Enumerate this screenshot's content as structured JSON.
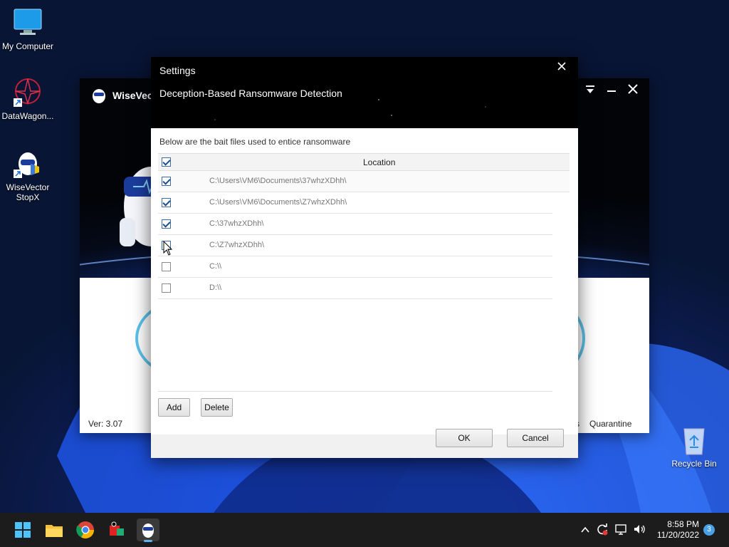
{
  "desktop": {
    "icons": [
      {
        "label": "My Computer"
      },
      {
        "label": "DataWagon..."
      },
      {
        "label": "WiseVector StopX"
      }
    ],
    "recycle_bin": "Recycle Bin"
  },
  "app": {
    "name": "WiseVec",
    "version": "Ver: 3.07",
    "footer_s": "s",
    "quarantine": "Quarantine"
  },
  "dialog": {
    "title": "Settings",
    "subtitle": "Deception-Based Ransomware Detection",
    "description": "Below are the bait files used to entice ransomware",
    "column_location": "Location",
    "header_checked": true,
    "rows": [
      {
        "path": "C:\\Users\\VM6\\Documents\\37whzXDhh\\",
        "checked": true
      },
      {
        "path": "C:\\Users\\VM6\\Documents\\Z7whzXDhh\\",
        "checked": true
      },
      {
        "path": "C:\\37whzXDhh\\",
        "checked": true
      },
      {
        "path": "C:\\Z7whzXDhh\\",
        "checked": false
      },
      {
        "path": "C:\\\\",
        "checked": false
      },
      {
        "path": "D:\\\\",
        "checked": false
      }
    ],
    "add_label": "Add",
    "delete_label": "Delete",
    "ok_label": "OK",
    "cancel_label": "Cancel"
  },
  "taskbar": {
    "time": "8:58 PM",
    "date": "11/20/2022",
    "notification_count": "3",
    "icons": [
      "windows-start-icon",
      "file-explorer-icon",
      "chrome-icon",
      "media-app-icon",
      "wisevector-icon"
    ]
  },
  "colors": {
    "accent": "#5fb2f2",
    "checkbox_check": "#1f4d8c",
    "ring": "#5bc2ea"
  }
}
